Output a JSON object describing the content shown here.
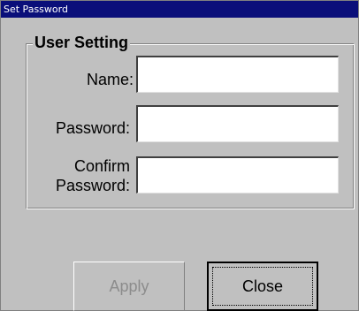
{
  "window": {
    "title": "Set Password"
  },
  "group": {
    "legend": "User Setting"
  },
  "fields": {
    "name": {
      "label": "Name:",
      "value": ""
    },
    "password": {
      "label": "Password:",
      "value": ""
    },
    "confirm": {
      "label_line1": "Confirm",
      "label_line2": "Password:",
      "value": ""
    }
  },
  "buttons": {
    "apply": "Apply",
    "close": "Close"
  },
  "colors": {
    "titlebar": "#0a0f7a",
    "face": "#c0c0c0",
    "disabled_text": "#8c8c8c"
  }
}
